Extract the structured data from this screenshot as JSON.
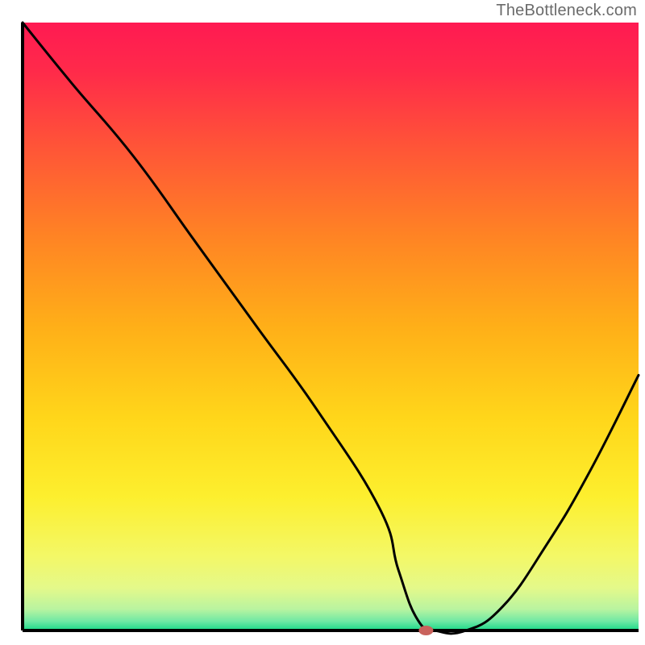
{
  "watermark": "TheBottleneck.com",
  "chart_data": {
    "type": "line",
    "title": "",
    "xlabel": "",
    "ylabel": "",
    "xlim": [
      0,
      100
    ],
    "ylim": [
      0,
      100
    ],
    "grid": false,
    "legend": false,
    "series": [
      {
        "name": "bottleneck-curve",
        "x": [
          0,
          8,
          18,
          28,
          38,
          48,
          58,
          61,
          64,
          67,
          72,
          78,
          85,
          92,
          100
        ],
        "values": [
          100,
          90,
          78,
          64,
          50,
          36,
          20,
          10,
          2,
          0,
          0,
          4,
          14,
          26,
          42
        ]
      }
    ],
    "marker": {
      "name": "optimal-point",
      "x": 65.5,
      "y": 0,
      "rx": 9,
      "ry": 6,
      "fill": "#c9625c"
    },
    "background_gradient": {
      "stops": [
        {
          "offset": 0.0,
          "color": "#ff1a52"
        },
        {
          "offset": 0.08,
          "color": "#ff2a4a"
        },
        {
          "offset": 0.2,
          "color": "#ff5338"
        },
        {
          "offset": 0.35,
          "color": "#ff8324"
        },
        {
          "offset": 0.5,
          "color": "#ffaf18"
        },
        {
          "offset": 0.65,
          "color": "#ffd61a"
        },
        {
          "offset": 0.78,
          "color": "#fdef2e"
        },
        {
          "offset": 0.88,
          "color": "#f3f868"
        },
        {
          "offset": 0.93,
          "color": "#e4f98a"
        },
        {
          "offset": 0.965,
          "color": "#b9f4a0"
        },
        {
          "offset": 0.985,
          "color": "#6ee8a4"
        },
        {
          "offset": 1.0,
          "color": "#18d888"
        }
      ]
    },
    "axis_color": "#000000",
    "curve_color": "#000000",
    "curve_width": 3
  }
}
